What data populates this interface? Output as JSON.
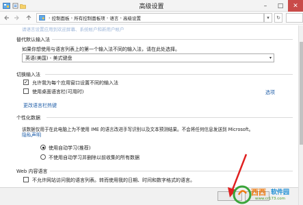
{
  "window": {
    "title": "高级设置",
    "minimize_glyph": "–",
    "maximize_glyph": "□",
    "close_glyph": "✕"
  },
  "nav": {
    "back_icon": "arrow-left-icon",
    "forward_icon": "arrow-right-icon",
    "up_icon": "arrow-up-icon",
    "breadcrumb": [
      "控制面板",
      "所有控制面板项",
      "语言",
      "高级设置"
    ],
    "separator": "›",
    "dropdown_glyph": "▾",
    "refresh_glyph": "↻"
  },
  "top_link": "请语言设置应用到欢迎屏幕、系统帐户和新用户帐户",
  "override_input": {
    "heading": "替代默认输入法",
    "description": "如果你想使用与语言列表上的第一个输入法不同的输入法，请在此处选择。",
    "selected": "英语(美国) - 美式键盘",
    "arrow_glyph": "▾"
  },
  "switch_input": {
    "heading": "切换输入法",
    "option1_label": "允许我为每个应用窗口设置不同的输入法",
    "option1_checked": true,
    "option2_label": "使用桌面语言栏(可用时)",
    "option2_checked": false,
    "options_link": "选项",
    "hotkeys_link": "更改语言栏热键"
  },
  "personalization": {
    "heading": "个性化数据",
    "description": "该数据仅用于在此电脑上为不使用 IME 的语言改进手写识别以及文本预测结果。不会将任何信息发送到 Microsoft。",
    "privacy_link": "隐私声明",
    "radio1_label": "使用自动学习(推荐)",
    "radio1_selected": true,
    "radio2_label": "不使用自动学习并删除以前收集的所有数据",
    "radio2_selected": false
  },
  "web_content": {
    "heading": "Web 内容语言",
    "checkbox_label": "不允许网站访问我的语言列表。转而使用我的日期、时间和数字格式的语言。",
    "checked": false
  },
  "checkmark_glyph": "✓",
  "watermark": {
    "text_main": "西西",
    "text_sub": "软件园",
    "url": "www.cr173.com"
  },
  "colors": {
    "link": "#1f5ea8",
    "arrow": "#e02020",
    "close": "#c94b49"
  }
}
